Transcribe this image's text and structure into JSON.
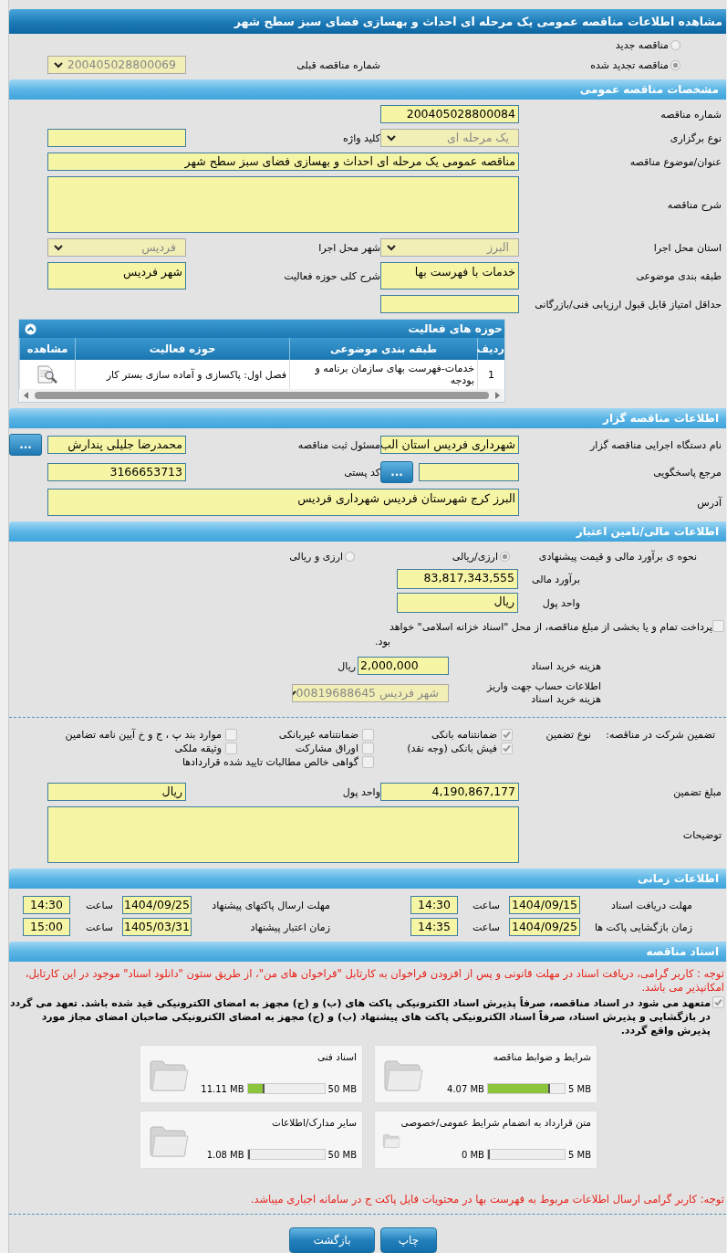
{
  "title": "مشاهده اطلاعات مناقصه عمومی یک مرحله ای احداث و بهسازی فضای سبز سطح شهر",
  "tender_type": [
    {
      "label": "مناقصه جدید",
      "selected": false
    },
    {
      "label": "مناقصه تجدید شده",
      "selected": true
    }
  ],
  "previous_tender": {
    "label": "شماره مناقصه قبلی",
    "value": "200405028800069",
    "kind": "select"
  },
  "general": {
    "title": "مشخصات مناقصه عمومی",
    "rows": [
      {
        "right": {
          "label": "شماره مناقصه",
          "value": "200405028800084",
          "kind": "text"
        }
      },
      {
        "right": {
          "label": "نوع برگزاری",
          "value": "یک مرحله ای",
          "kind": "select"
        },
        "left": {
          "label": "کلید واژه",
          "kind": "text"
        }
      },
      {
        "wide": {
          "label": "عنوان/موضوع مناقصه",
          "value": "مناقصه عمومی یک مرحله ای احداث و بهسازی فضای سبز سطح شهر",
          "kind": "text"
        }
      },
      {
        "wide": {
          "label": "شرح مناقصه",
          "kind": "textarea"
        }
      },
      {
        "right": {
          "label": "استان محل اجرا",
          "value": "البرز",
          "kind": "select"
        },
        "left": {
          "label": "شهر محل اجرا",
          "value": "فردیس",
          "kind": "select"
        }
      },
      {
        "right": {
          "label": "طبقه بندی موضوعی",
          "value": "خدمات با فهرست بها",
          "kind": "tall"
        },
        "left": {
          "label": "شرح کلی حوزه فعالیت",
          "value": "شهر فردیس",
          "kind": "tall"
        }
      },
      {
        "right": {
          "label": "حداقل امتیاز قابل قبول ارزیابی فنی/بازرگانی",
          "kind": "text"
        }
      }
    ],
    "activities": {
      "title": "حوزه های فعالیت",
      "columns": [
        "ردیف",
        "طبقه بندی موضوعی",
        "حوزه فعالیت",
        "مشاهده"
      ],
      "rows": [
        [
          "1",
          "خدمات-فهرست بهای سازمان برنامه و بودجه",
          "فصل اول:  پاکسازی و آماده سازی بستر کار"
        ]
      ]
    }
  },
  "organizer": {
    "title": "اطلاعات مناقصه گزار",
    "rows": [
      {
        "right": {
          "label": "نام دستگاه اجرایی مناقصه گزار",
          "value": "شهرداری فردیس استان الب",
          "kind": "text"
        },
        "left": {
          "label": "مسئول ثبت مناقصه",
          "value": "محمدرضا جلیلی پندارش",
          "kind": "text",
          "button": "..."
        }
      },
      {
        "right": {
          "label": "مرجع پاسخگویی",
          "kind": "text",
          "button": "..."
        },
        "left": {
          "label": "کد پستی",
          "value": "3166653713",
          "kind": "text"
        }
      },
      {
        "wide": {
          "label": "آدرس",
          "value": "البرز کرج شهرستان فردیس شهرداری فردیس",
          "kind": "tall"
        }
      }
    ]
  },
  "finance": {
    "title": "اطلاعات مالی/تامین اعتبار",
    "estimate_method": {
      "label": "نحوه ی برآورد مالی و قیمت پیشنهادی",
      "options": [
        {
          "label": "ارزی/ریالی",
          "selected": true
        },
        {
          "label": "ارزی و ریالی",
          "selected": false
        }
      ]
    },
    "fields": [
      {
        "label": "برآورد مالی",
        "value": "83,817,343,555"
      },
      {
        "label": "واحد پول",
        "value": "ریال"
      }
    ],
    "treasury": {
      "label": "پرداخت تمام و یا بخشی از مبلغ مناقصه، از محل \"اسناد خزانه اسلامی\" خواهد بود.",
      "checked": false
    },
    "document_fee": {
      "label": "هزینه خرید اسناد",
      "value": "2,000,000",
      "unit": "ریال"
    },
    "account": {
      "label": "اطلاعات حساب جهت واریز هزینه خرید اسناد",
      "value": "شهر فردیس 00819688645"
    }
  },
  "guarantee": {
    "label": "تضمین شرکت در مناقصه:",
    "type_label": "نوع تضمین",
    "options": [
      {
        "label": "ضمانتنامه بانکی",
        "checked": true
      },
      {
        "label": "ضمانتنامه غیربانکی",
        "checked": false
      },
      {
        "label": "موارد بند پ ، ج و خ آیین نامه تضامین",
        "checked": false
      },
      {
        "label": "فیش بانکی (وجه نقد)",
        "checked": true
      },
      {
        "label": "اوراق مشارکت",
        "checked": false
      },
      {
        "label": "وثیقه ملکی",
        "checked": false
      },
      {
        "label": "گواهی خالص مطالبات تایید شده قراردادها",
        "checked": false
      }
    ],
    "amount": {
      "label": "مبلغ تضمین",
      "value": "4,190,867,177"
    },
    "currency": {
      "label": "واحد پول",
      "value": "ریال"
    },
    "notes": {
      "label": "توضیحات"
    }
  },
  "timing": {
    "title": "اطلاعات زمانی",
    "items": [
      {
        "label": "مهلت دریافت اسناد",
        "date": "1404/09/15",
        "time_label": "ساعت",
        "time": "14:30"
      },
      {
        "label": "مهلت ارسال پاکتهای پیشنهاد",
        "date": "1404/09/25",
        "time_label": "ساعت",
        "time": "14:30"
      },
      {
        "label": "زمان بازگشایی پاکت ها",
        "date": "1404/09/25",
        "time_label": "ساعت",
        "time": "14:35"
      },
      {
        "label": "زمان اعتبار پیشنهاد",
        "date": "1405/03/31",
        "time_label": "ساعت",
        "time": "15:00"
      }
    ]
  },
  "documents": {
    "title": "اسناد مناقصه",
    "notice": "توجه : کاربر گرامی، دریافت اسناد در مهلت قانونی و پس از افزودن فراخوان به کارتابل \"فراخوان های من\"، از طریق ستون \"دانلود اسناد\" موجود در این کارتابل، امکانپذیر می باشد.",
    "commitment": {
      "text": "متعهد می شود در اسناد مناقصه، صرفاً پذیرش اسناد الکترونیکی پاکت های (ب) و (ج) مجهز به امضای الکترونیکی قید شده باشد. تعهد می گردد در بازگشایی و پذیرش اسناد، صرفاً اسناد الکترونیکی پاکت های پیشنهاد (ب) و (ج) مجهز به امضای الکترونیکی صاحبان امضای مجاز مورد پذیرش واقع گردد.",
      "checked": true
    },
    "files": [
      {
        "title": "شرایط و ضوابط مناقصه",
        "max": "5 MB",
        "used": "4.07 MB",
        "level": 0.81
      },
      {
        "title": "اسناد فنی",
        "max": "50 MB",
        "used": "11.11 MB",
        "level": 0.22
      },
      {
        "title": "متن قرارداد به انضمام شرایط عمومی/خصوصی",
        "max": "5 MB",
        "used": "0 MB",
        "level": 0
      },
      {
        "title": "سایر مدارک/اطلاعات",
        "max": "50 MB",
        "used": "1.08 MB",
        "level": 0.02
      }
    ],
    "note": "توجه: کاربر گرامی ارسال اطلاعات مربوط به فهرست بها در محتویات فایل پاکت ج در سامانه اجباری میباشد."
  },
  "buttons": [
    {
      "label": "چاپ"
    },
    {
      "label": "بازگشت"
    }
  ]
}
